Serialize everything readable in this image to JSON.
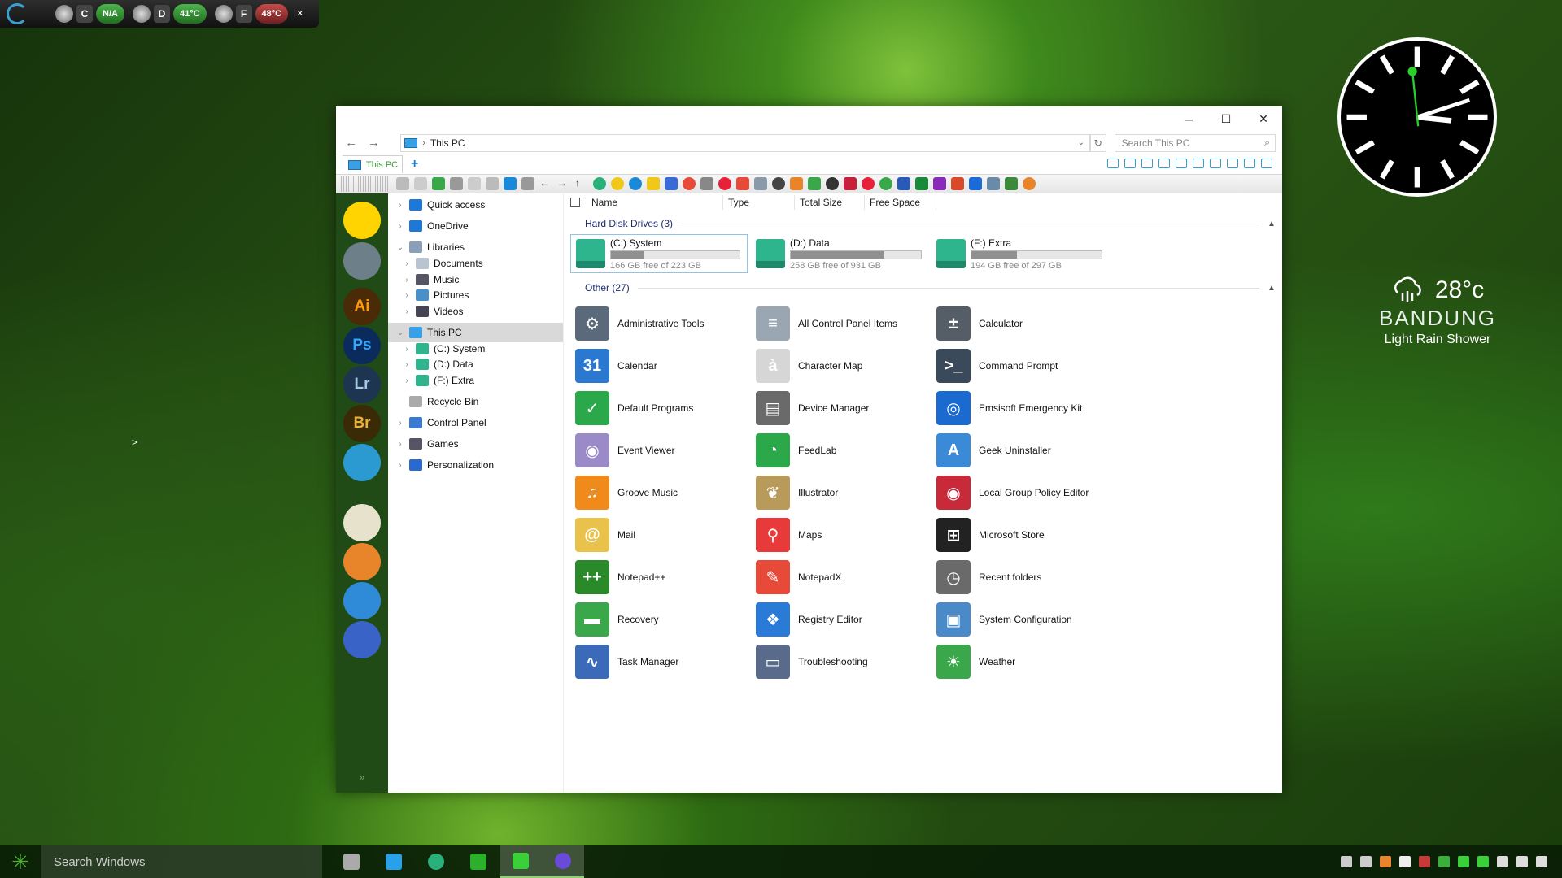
{
  "gauges": {
    "drive_c": "C",
    "c_value": "N/A",
    "drive_d": "D",
    "d_value": "41°C",
    "drive_f": "F",
    "f_value": "48°C",
    "close": "✕"
  },
  "clock": {
    "hour": 3,
    "minute": 12,
    "second": 59
  },
  "weather": {
    "temperature": "28°c",
    "city": "BANDUNG",
    "condition": "Light Rain Shower"
  },
  "window": {
    "minimize": "─",
    "maximize": "☐",
    "close": "✕",
    "back": "←",
    "forward": "→",
    "breadcrumb": "This PC",
    "search_placeholder": "Search This PC",
    "tab_label": "This PC",
    "new_tab": "+"
  },
  "launcher": {
    "apps": [
      {
        "name": "chameleon",
        "label": "",
        "bg": "#ffd400",
        "fg": "#2a6a18"
      },
      {
        "name": "avatar",
        "label": "",
        "bg": "#6d7f88",
        "fg": "#fff"
      },
      {
        "name": "illustrator",
        "label": "Ai",
        "bg": "#4a2a07",
        "fg": "#ff9a00"
      },
      {
        "name": "photoshop",
        "label": "Ps",
        "bg": "#0b2b5c",
        "fg": "#31a8ff"
      },
      {
        "name": "lightroom",
        "label": "Lr",
        "bg": "#1d3550",
        "fg": "#a7c8e8"
      },
      {
        "name": "bridge",
        "label": "Br",
        "bg": "#3b2a06",
        "fg": "#e8b23a"
      },
      {
        "name": "sunflower",
        "label": "",
        "bg": "#2a9ad0",
        "fg": "#ffd400"
      },
      {
        "name": "inkscape",
        "label": "",
        "bg": "#e6e2cc",
        "fg": "#333"
      },
      {
        "name": "gimp",
        "label": "",
        "bg": "#e8842a",
        "fg": "#fff"
      },
      {
        "name": "chrome-like",
        "label": "",
        "bg": "#2f8ad8",
        "fg": "#fff"
      },
      {
        "name": "firefox",
        "label": "",
        "bg": "#3a63c8",
        "fg": "#ff8a3a"
      }
    ],
    "more": "»"
  },
  "nav": [
    {
      "label": "Quick access",
      "icon": "star",
      "color": "#1e78d7"
    },
    {
      "label": "OneDrive",
      "icon": "cloud",
      "color": "#1e78d7"
    },
    {
      "label": "Libraries",
      "icon": "folder",
      "color": "#8aa0b8"
    },
    {
      "label": "Documents",
      "icon": "doc",
      "color": "#b8c4d0"
    },
    {
      "label": "Music",
      "icon": "note",
      "color": "#556"
    },
    {
      "label": "Pictures",
      "icon": "picture",
      "color": "#4a90c8"
    },
    {
      "label": "Videos",
      "icon": "video",
      "color": "#445"
    },
    {
      "label": "This PC",
      "icon": "pc",
      "color": "#39a0e6"
    },
    {
      "label": "(C:) System",
      "icon": "drive",
      "color": "#2fb58e"
    },
    {
      "label": "(D:) Data",
      "icon": "drive",
      "color": "#2fb58e"
    },
    {
      "label": "(F:) Extra",
      "icon": "drive",
      "color": "#2fb58e"
    },
    {
      "label": "Recycle Bin",
      "icon": "bin",
      "color": "#aaa"
    },
    {
      "label": "Control Panel",
      "icon": "cpanel",
      "color": "#3a7ad0"
    },
    {
      "label": "Games",
      "icon": "gamepad",
      "color": "#556"
    },
    {
      "label": "Personalization",
      "icon": "monitor",
      "color": "#2a6ad0"
    }
  ],
  "columns": {
    "name": "Name",
    "type": "Type",
    "total": "Total Size",
    "free": "Free Space"
  },
  "groups": {
    "drives": "Hard Disk Drives (3)",
    "other": "Other (27)"
  },
  "drives": [
    {
      "name": "(C:) System",
      "free": "166 GB free of 223 GB",
      "used_fraction": 0.26
    },
    {
      "name": "(D:) Data",
      "free": "258 GB free of 931 GB",
      "used_fraction": 0.72
    },
    {
      "name": "(F:) Extra",
      "free": "194 GB free of 297 GB",
      "used_fraction": 0.35
    }
  ],
  "items": [
    {
      "label": "Administrative Tools",
      "color": "#5a6a7a",
      "glyph": "⚙"
    },
    {
      "label": "All Control Panel Items",
      "color": "#9aa6b2",
      "glyph": "≡"
    },
    {
      "label": "Calculator",
      "color": "#555e66",
      "glyph": "±"
    },
    {
      "label": "Calendar",
      "color": "#2a78d0",
      "glyph": "31"
    },
    {
      "label": "Character Map",
      "color": "#d6d6d6",
      "glyph": "à"
    },
    {
      "label": "Command Prompt",
      "color": "#3a4a5a",
      "glyph": ">_"
    },
    {
      "label": "Default Programs",
      "color": "#2aa84a",
      "glyph": "✓"
    },
    {
      "label": "Device Manager",
      "color": "#6a6a6a",
      "glyph": "▤"
    },
    {
      "label": "Emsisoft Emergency Kit",
      "color": "#1a6ad0",
      "glyph": "◎"
    },
    {
      "label": "Event Viewer",
      "color": "#9a8ac8",
      "glyph": "◉"
    },
    {
      "label": "FeedLab",
      "color": "#2aa84a",
      "glyph": "◔"
    },
    {
      "label": "Geek Uninstaller",
      "color": "#3a8ad8",
      "glyph": "A"
    },
    {
      "label": "Groove Music",
      "color": "#f08a1a",
      "glyph": "♫"
    },
    {
      "label": "Illustrator",
      "color": "#b89a5a",
      "glyph": "❦"
    },
    {
      "label": "Local Group Policy Editor",
      "color": "#c82a3a",
      "glyph": "◉"
    },
    {
      "label": "Mail",
      "color": "#e8c24a",
      "glyph": "@"
    },
    {
      "label": "Maps",
      "color": "#e83a3a",
      "glyph": "⚲"
    },
    {
      "label": "Microsoft Store",
      "color": "#222222",
      "glyph": "⊞"
    },
    {
      "label": "Notepad++",
      "color": "#2a8a2a",
      "glyph": "++"
    },
    {
      "label": "NotepadX",
      "color": "#e84a3a",
      "glyph": "✎"
    },
    {
      "label": "Recent folders",
      "color": "#6a6a6a",
      "glyph": "◷"
    },
    {
      "label": "Recovery",
      "color": "#3aa84a",
      "glyph": "▬"
    },
    {
      "label": "Registry Editor",
      "color": "#2a7ad8",
      "glyph": "❖"
    },
    {
      "label": "System Configuration",
      "color": "#4a8ac8",
      "glyph": "▣"
    },
    {
      "label": "Task Manager",
      "color": "#3a6ab8",
      "glyph": "∿"
    },
    {
      "label": "Troubleshooting",
      "color": "#5a6a8a",
      "glyph": "▭"
    },
    {
      "label": "Weather",
      "color": "#3aa84a",
      "glyph": "☀"
    }
  ],
  "desktop_arrow": ">",
  "taskbar": {
    "start_glyph": "✳",
    "search_placeholder": "Search Windows",
    "apps": [
      {
        "name": "task-view",
        "color": "#aaa"
      },
      {
        "name": "notes",
        "color": "#2aa0e6"
      },
      {
        "name": "edge",
        "color": "#2ab07a"
      },
      {
        "name": "file-explorer",
        "color": "#2ab02a"
      },
      {
        "name": "green-app",
        "color": "#3ad03a"
      },
      {
        "name": "firefox-app",
        "color": "#6a4ad8"
      }
    ],
    "tray": [
      {
        "name": "people",
        "color": "#ccc"
      },
      {
        "name": "chevron-up",
        "color": "#ccc"
      },
      {
        "name": "search-tray",
        "color": "#e8842a"
      },
      {
        "name": "onedrive",
        "color": "#eee"
      },
      {
        "name": "security",
        "color": "#c83a3a"
      },
      {
        "name": "updates",
        "color": "#3ab03a"
      },
      {
        "name": "green-check",
        "color": "#3ad03a"
      },
      {
        "name": "cpu-meter",
        "color": "#3ad03a"
      },
      {
        "name": "network",
        "color": "#ddd"
      },
      {
        "name": "volume",
        "color": "#ddd"
      },
      {
        "name": "notifications",
        "color": "#ddd"
      }
    ]
  }
}
